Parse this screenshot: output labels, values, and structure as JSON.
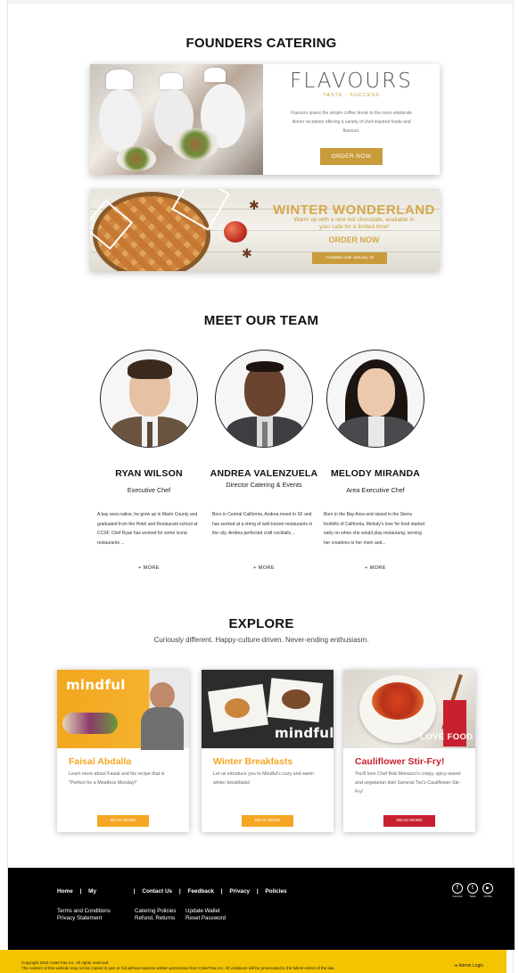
{
  "header": {
    "title": "FOUNDERS CATERING"
  },
  "flavours": {
    "title": "FLAVOURS",
    "subtitle": "TASTE : SUCCESS",
    "description": "Flavours spans the simple coffee break to the more elaborate dinner reception offering a variety of chef-inspired foods and flavours.",
    "button": "ORDER NOW"
  },
  "winter": {
    "title": "WINTER WONDERLAND",
    "description": "Warm up with a nice hot chocolate, available in your cafe for a limited time!",
    "order": "ORDER NOW",
    "availability": "Available until January 15"
  },
  "team": {
    "heading": "MEET OUR TEAM",
    "more_label": "+ MORE",
    "members": [
      {
        "name": "RYAN WILSON",
        "role": "Executive Chef",
        "bio": "A bay area native, he grew up in Marin County and graduated from the Hotel and Restaurant school at CCSF. Chef Ryan has worked for some iconic restaurants ..."
      },
      {
        "name": "ANDREA VALENZUELA",
        "role": "Director Catering & Events",
        "bio": "Born in Central California, Andrea moed to SF and has worked at a string of well-known restaurants in the city. Andrea perfected craft cocktails..."
      },
      {
        "name": "MELODY MIRANDA",
        "role": "Area Executive Chef",
        "bio": "Born in the Bay Area and raised in the Sierra foothills of California, Melody's love for food started early on when she would play restaurang; serving her creations to her mom and..."
      }
    ]
  },
  "explore": {
    "heading": "EXPLORE",
    "tagline": "Curiously different. Happy-culture-driven. Never-ending enthusiasm.",
    "cards": [
      {
        "logo": "mindful",
        "title": "Faisal Abdalla",
        "description": "Learn more about Faisal and his recipe that is \"Perfect for a Meatless Monday!\"",
        "button": "READ MORE",
        "color": "#f5a623"
      },
      {
        "logo": "mindful",
        "title": "Winter Breakfasts",
        "description": "Let us introduce you to Mindful's cozy and warm winter breakfasts!",
        "button": "READ MORE",
        "color": "#f5a623"
      },
      {
        "logo": "LOVE FOOD",
        "title": "Cauliflower Stir-Fry!",
        "description": "You'll love Chef Rob Morasco's crispy, spicy-sweet and vegetarian dish General Tso's Cauliflower Stir-Fry!",
        "button": "READ MORE",
        "color": "#c8202f"
      }
    ]
  },
  "footer": {
    "nav": [
      "Home",
      "|",
      "My",
      "|",
      "Contact Us",
      "|",
      "Feedback",
      "|",
      "Privacy",
      "|",
      "Policies"
    ],
    "col1": [
      "Terms and Conditions",
      "Privacy Statement"
    ],
    "col2": [
      "Catering Policies",
      "Refund, Returns"
    ],
    "col3": [
      "Update Wallet",
      "Reset Password"
    ],
    "social": [
      {
        "icon": "facebook-icon",
        "glyph": "f",
        "label": "Facebook"
      },
      {
        "icon": "twitter-icon",
        "glyph": "t",
        "label": "Twitter"
      },
      {
        "icon": "youtube-icon",
        "glyph": "▶",
        "label": "YouTube"
      }
    ],
    "copyright": "Copyright 2019 CaterTrax Inc. All rights reserved.",
    "notice": "The content of this website may not be copied in part or full without express written permission from CaterTrax Inc. All violations will be prosecuted to the fullest extent of the law.",
    "admin": "Admin Login"
  },
  "colors": {
    "gold": "#c99b3b",
    "orange": "#f5a623",
    "red": "#c8202f",
    "footer_bg": "#000000",
    "bar": "#f5c400"
  }
}
